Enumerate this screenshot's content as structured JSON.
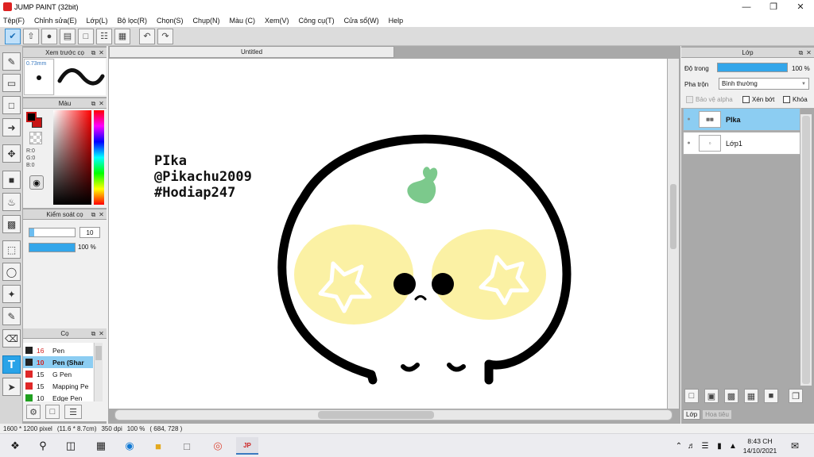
{
  "window": {
    "title": "JUMP PAINT (32bit)",
    "controls": [
      "minimize-icon",
      "restore-icon",
      "close-icon"
    ]
  },
  "menu": [
    "Tệp(F)",
    "Chỉnh sửa(E)",
    "Lớp(L)",
    "Bộ lọc(R)",
    "Chọn(S)",
    "Chụp(N)",
    "Màu (C)",
    "Xem(V)",
    "Công cụ(T)",
    "Cửa sổ(W)",
    "Help"
  ],
  "toolbar": {
    "icons": [
      "brush-settings-icon",
      "export-icon",
      "speech-bubble-icon",
      "comment-icon",
      "page-icon",
      "page-settings-icon",
      "grid-page-icon",
      "undo-icon",
      "redo-icon"
    ]
  },
  "tools": [
    "pen-icon",
    "eraser-icon",
    "rectangle-icon",
    "line-icon",
    "move-icon",
    "fill-square-icon",
    "bucket-icon",
    "gradient-icon",
    "rect-select-icon",
    "lasso-icon",
    "magic-wand-icon",
    "select-pen-icon",
    "select-erase-icon",
    "text-tool-icon",
    "operation-icon"
  ],
  "preview_panel": {
    "title": "Xem trước cọ",
    "size": "0.73mm"
  },
  "color_panel": {
    "title": "Màu",
    "r": "R:0",
    "g": "G:0",
    "b": "B:0",
    "current_color": "#000000",
    "secondary_color": "#c81414"
  },
  "brush_control": {
    "title": "Kiểm soát cọ",
    "size_value": "10",
    "opacity_value": "100 %",
    "size_fraction": 0.1,
    "opacity_fraction": 1.0
  },
  "brush_panel": {
    "title": "Cọ",
    "items": [
      {
        "size": "16",
        "name": "Pen",
        "color": "#222222",
        "size_color": "#d02020",
        "selected": false
      },
      {
        "size": "10",
        "name": "Pen (Shar",
        "color": "#222222",
        "size_color": "#d02020",
        "selected": true
      },
      {
        "size": "15",
        "name": "G Pen",
        "color": "#e02828",
        "size_color": "#111111",
        "selected": false
      },
      {
        "size": "15",
        "name": "Mapping Pe",
        "color": "#e02828",
        "size_color": "#111111",
        "selected": false
      },
      {
        "size": "10",
        "name": "Edge Pen",
        "color": "#20a020",
        "size_color": "#111111",
        "selected": false
      }
    ]
  },
  "document": {
    "tab_title": "Untitled",
    "canvas_text": [
      "PIka",
      "@Pikachu2009",
      "#Hodiap247"
    ]
  },
  "layer_panel": {
    "title": "Lớp",
    "opacity_label": "Độ trong",
    "opacity_value": "100 %",
    "opacity_fraction": 1.0,
    "blend_label": "Pha trộn",
    "blend_value": "Bình thường",
    "protect_alpha": "Bảo vệ alpha",
    "clipping": "Xén bớt",
    "lock": "Khóa",
    "layers": [
      {
        "name": "PIka",
        "selected": true
      },
      {
        "name": "Lớp1",
        "selected": false
      }
    ],
    "bottom_tabs": [
      "Lớp",
      "Hoa tiêu"
    ]
  },
  "status": {
    "size": "1600 * 1200 pixel",
    "physical": "(11.6 * 8.7cm)",
    "dpi": "350 dpi",
    "zoom": "100 %",
    "coords": "( 684, 728 )"
  },
  "taskbar": {
    "time": "8:43 CH",
    "date": "14/10/2021"
  }
}
